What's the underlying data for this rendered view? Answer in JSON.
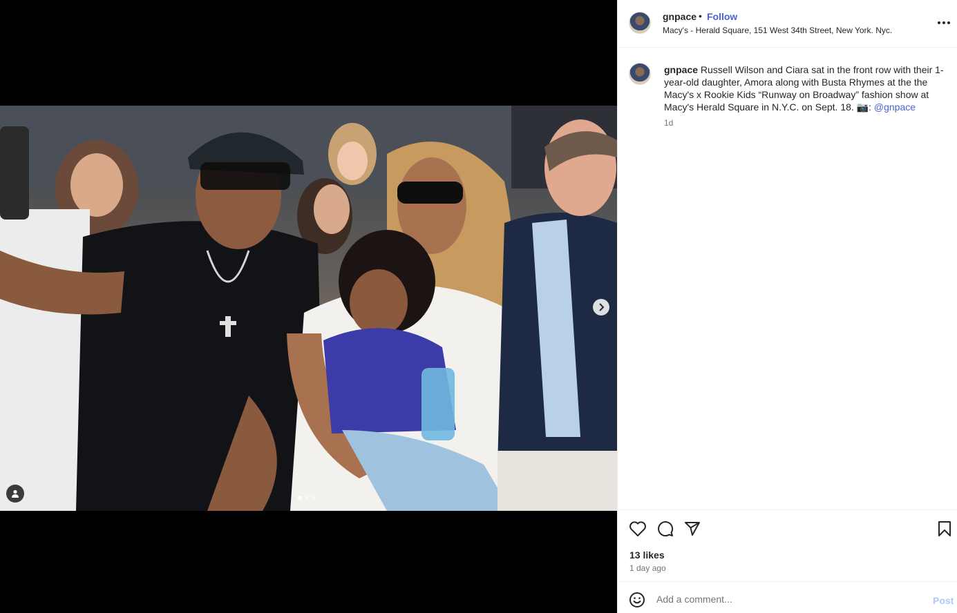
{
  "post": {
    "username": "gnpace",
    "separator": "•",
    "follow_label": "Follow",
    "location": "Macy's - Herald Square, 151 West 34th Street, New York. Nyc.",
    "caption_user": "gnpace",
    "caption_text": "Russell Wilson and Ciara sat in the front row with their 1-year-old daughter, Amora along with Busta Rhymes at the the Macy's x Rookie Kids “Runway on Broadway” fashion show at Macy's Herald Square in N.Y.C. on Sept. 18. 📷: ",
    "caption_mention": "@gnpace",
    "caption_time": "1d",
    "likes": "13 likes",
    "posted_ago": "1 day ago"
  },
  "media": {
    "slides": 3,
    "active_slide": 1
  },
  "comment": {
    "placeholder": "Add a comment...",
    "post_label": "Post"
  },
  "icons": {
    "like": "heart-icon",
    "comment": "comment-icon",
    "share": "share-icon",
    "save": "bookmark-icon",
    "emoji": "emoji-icon",
    "more": "more-icon",
    "next": "chevron-right-icon",
    "tags": "user-tag-icon"
  },
  "colors": {
    "link": "#4a63cf",
    "post_disabled": "#b2c8f5",
    "secondary_text": "#737373"
  }
}
